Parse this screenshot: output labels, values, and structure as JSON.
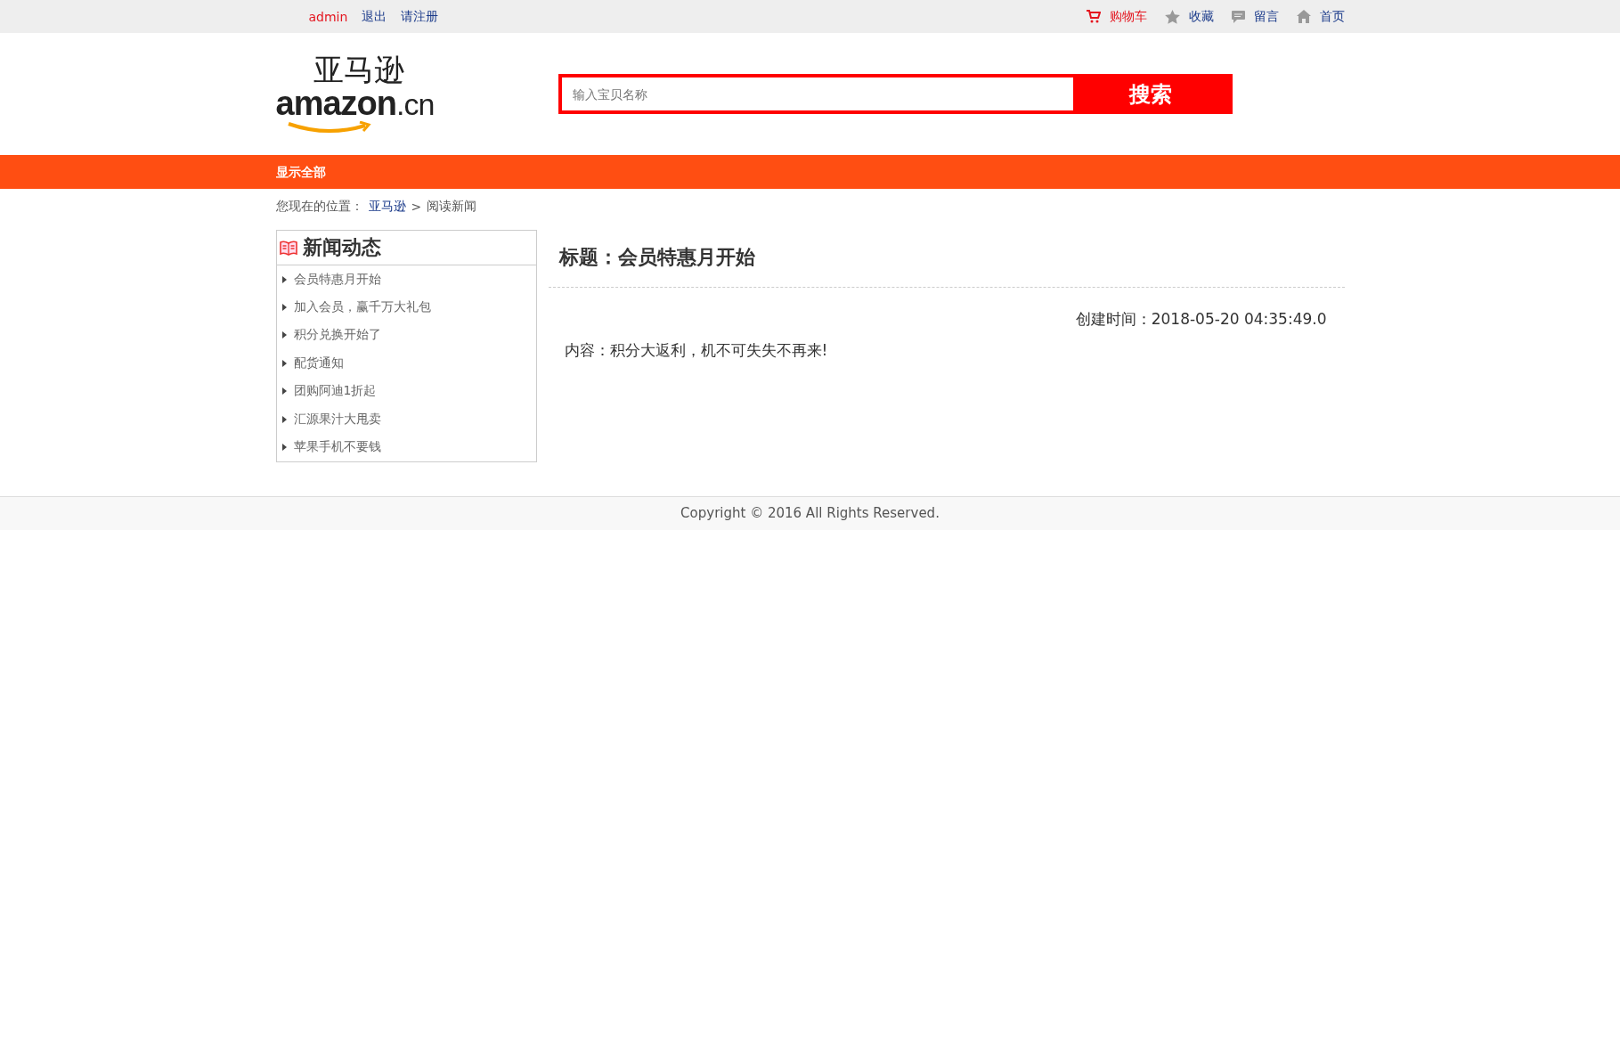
{
  "top_bar": {
    "left_links": [
      {
        "label": "admin",
        "kind": "user"
      },
      {
        "label": "退出",
        "kind": "link"
      },
      {
        "label": "请注册",
        "kind": "link"
      }
    ],
    "right_links": [
      {
        "label": "购物车",
        "kind": "cart"
      },
      {
        "label": "收藏",
        "kind": "star"
      },
      {
        "label": "留言",
        "kind": "message"
      },
      {
        "label": "首页",
        "kind": "home"
      }
    ]
  },
  "logo": {
    "chinese": "亚马逊",
    "latin": "amazon",
    "suffix": ".cn"
  },
  "search": {
    "placeholder": "输入宝贝名称",
    "button": "搜索"
  },
  "nav": {
    "items": [
      "显示全部"
    ]
  },
  "breadcrumb": {
    "prefix": "您现在的位置：",
    "link": "亚马逊",
    "separator": ">",
    "current": "阅读新闻"
  },
  "sidebar": {
    "title": "新闻动态",
    "items": [
      "会员特惠月开始",
      "加入会员，赢千万大礼包",
      "积分兑换开始了",
      "配货通知",
      "团购阿迪1折起",
      "汇源果汁大甩卖",
      "苹果手机不要钱"
    ]
  },
  "article": {
    "title": "标题：会员特惠月开始",
    "created": "创建时间：2018-05-20 04:35:49.0",
    "content": "内容：积分大返利，机不可失失不再来!"
  },
  "footer": {
    "text": "Copyright © 2016 All Rights Reserved."
  }
}
